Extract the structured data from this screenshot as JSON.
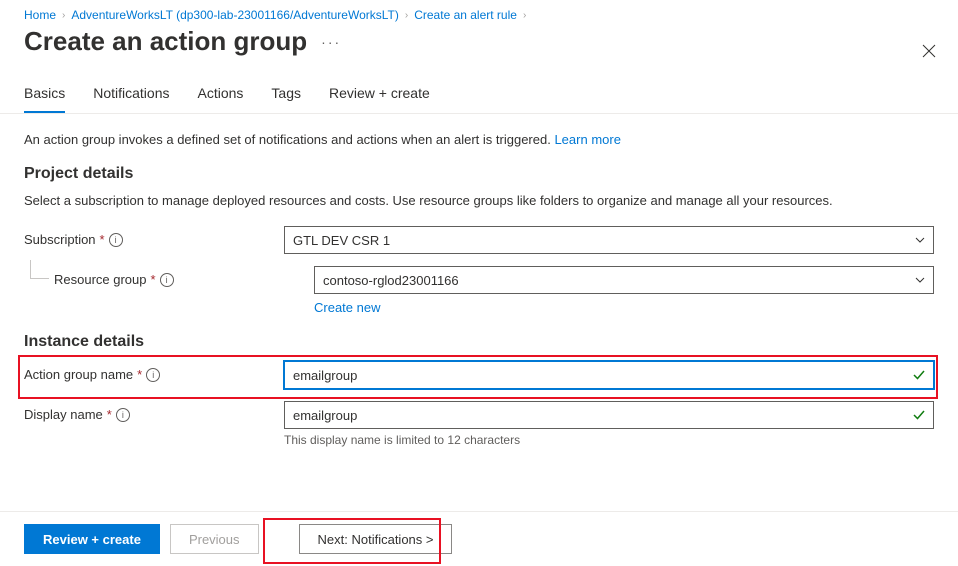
{
  "breadcrumb": {
    "home": "Home",
    "db": "AdventureWorksLT (dp300-lab-23001166/AdventureWorksLT)",
    "rule": "Create an alert rule"
  },
  "header": {
    "title": "Create an action group"
  },
  "tabs": {
    "basics": "Basics",
    "notifications": "Notifications",
    "actions": "Actions",
    "tags": "Tags",
    "review": "Review + create"
  },
  "body": {
    "desc": "An action group invokes a defined set of notifications and actions when an alert is triggered.",
    "learn": "Learn more",
    "project_heading": "Project details",
    "project_hint": "Select a subscription to manage deployed resources and costs. Use resource groups like folders to organize and manage all your resources.",
    "subscription_label": "Subscription",
    "subscription_value": "GTL DEV CSR 1",
    "rg_label": "Resource group",
    "rg_value": "contoso-rglod23001166",
    "create_new": "Create new",
    "instance_heading": "Instance details",
    "ag_label": "Action group name",
    "ag_value": "emailgroup",
    "dn_label": "Display name",
    "dn_value": "emailgroup",
    "dn_helper": "This display name is limited to 12 characters"
  },
  "footer": {
    "review": "Review + create",
    "previous": "Previous",
    "next": "Next: Notifications >"
  }
}
